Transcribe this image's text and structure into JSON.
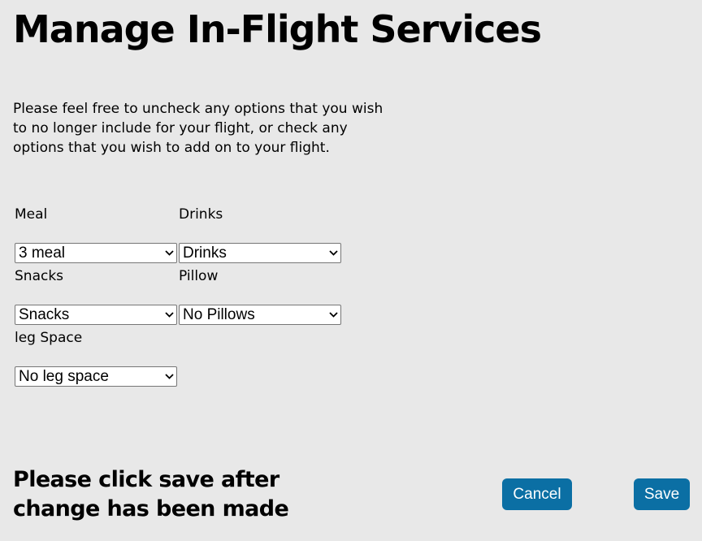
{
  "page": {
    "title": "Manage In-Flight Services",
    "intro": "Please feel free to uncheck any options that you wish to no longer include for your flight, or check any options that you wish to add on to your flight."
  },
  "fields": {
    "meal": {
      "label": "Meal",
      "value": "3 meal"
    },
    "drinks": {
      "label": "Drinks",
      "value": "Drinks"
    },
    "snacks": {
      "label": "Snacks",
      "value": "Snacks"
    },
    "pillow": {
      "label": "Pillow",
      "value": "No Pillows"
    },
    "leg_space": {
      "label": "leg Space",
      "value": "No leg space"
    }
  },
  "footer": {
    "note": "Please click save after change has been made",
    "cancel_label": "Cancel",
    "save_label": "Save"
  },
  "colors": {
    "background": "#e8e8e8",
    "button": "#0b6fa4",
    "button_text": "#ffffff"
  },
  "icons": {
    "select_arrow": "chevron-down-icon"
  }
}
